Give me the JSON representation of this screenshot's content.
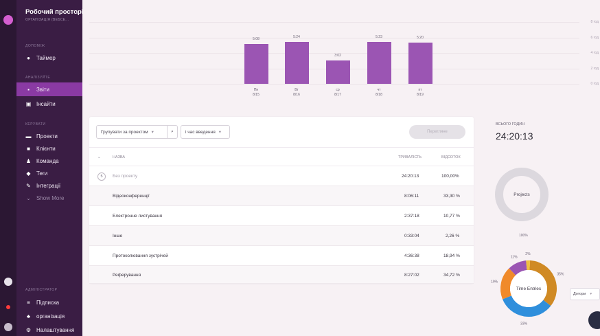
{
  "sidebar": {
    "workspace": "Робочий просторі",
    "workspace_sub": "ОРГАНІЗАЦІЯ (ВЕБСЕ...",
    "sections": {
      "track": "ДОПОМІЖ",
      "analyze": "АНАЛІЗУЙТЕ",
      "manage": "КЕРУВАТИ",
      "admin": "АДМІНІСТРАТОР"
    },
    "items": [
      {
        "label": "Таймер",
        "icon": "clock-icon"
      },
      {
        "label": "Звіти",
        "icon": "report-icon"
      },
      {
        "label": "Інсайти",
        "icon": "insights-icon"
      },
      {
        "label": "Проекти",
        "icon": "folder-icon"
      },
      {
        "label": "Клієнти",
        "icon": "client-icon"
      },
      {
        "label": "Команда",
        "icon": "team-icon"
      },
      {
        "label": "Теги",
        "icon": "tag-icon"
      },
      {
        "label": "Інтеграції",
        "icon": "plug-icon"
      },
      {
        "label": "Show More",
        "icon": "chevron-down-icon"
      },
      {
        "label": "Підписка",
        "icon": "list-icon"
      },
      {
        "label": "організація",
        "icon": "org-icon"
      },
      {
        "label": "Налаштування",
        "icon": "gear-icon"
      }
    ]
  },
  "chart_data": {
    "type": "bar",
    "categories": [
      "Пн 8/15",
      "Вт 8/16",
      "ср 8/17",
      "чт 8/18",
      "пт 8/19"
    ],
    "day_names": [
      "Пн",
      "Вт",
      "ср",
      "чт",
      "пт"
    ],
    "dates": [
      "8/15",
      "8/16",
      "8/17",
      "8/18",
      "8/19"
    ],
    "value_labels": [
      "5:08",
      "5:24",
      "3:02",
      "5:23",
      "5:20"
    ],
    "values": [
      5.13,
      5.4,
      3.03,
      5.38,
      5.33
    ],
    "y_ticks": [
      "8 год",
      "6 год",
      "4 год",
      "2 год",
      "0 год"
    ],
    "ylim": [
      0,
      8
    ],
    "color": "#9b55b3"
  },
  "toolbar": {
    "group_select": "Групувати за проектом",
    "search_icon": "search-icon",
    "sub_group_select": "і час введення",
    "export_label": "Перегляне"
  },
  "table": {
    "headers": {
      "name": "НАЗВА",
      "duration": "ТРИВАЛІСТЬ",
      "percent": "ВІДСОТОК"
    },
    "group": {
      "count": "5",
      "name": "Без проекту",
      "duration": "24:20:13",
      "percent": "100,00%"
    },
    "rows": [
      {
        "name": "Відеоконференції",
        "duration": "8:06:11",
        "percent": "33,30 %"
      },
      {
        "name": "Електронне листування",
        "duration": "2:37:18",
        "percent": "10,77 %"
      },
      {
        "name": "Інше",
        "duration": "0:33:04",
        "percent": "2,26 %"
      },
      {
        "name": "Протоколювання зустрічей",
        "duration": "4:36:38",
        "percent": "18,94 %"
      },
      {
        "name": "Реферування",
        "duration": "8:27:02",
        "percent": "34,72 %"
      }
    ]
  },
  "summary": {
    "total_label": "всього годин",
    "total_value": "24:20:13",
    "projects_label": "Projects",
    "projects_pct": "100%",
    "entries_label": "Time Entries",
    "slices": [
      {
        "label": "35%",
        "value": 34.72,
        "color": "#d08a24"
      },
      {
        "label": "33%",
        "value": 33.3,
        "color": "#2f8fdc"
      },
      {
        "label": "19%",
        "value": 18.94,
        "color": "#f08a2a"
      },
      {
        "label": "11%",
        "value": 10.77,
        "color": "#9b55b3"
      },
      {
        "label": "2%",
        "value": 2.26,
        "color": "#f0c040"
      }
    ],
    "sort_select": "Дотори"
  }
}
